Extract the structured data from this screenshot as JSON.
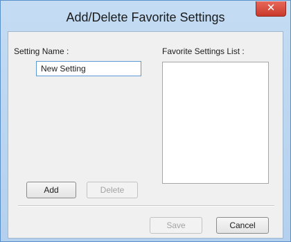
{
  "dialog": {
    "title": "Add/Delete Favorite Settings",
    "close_glyph": "✕"
  },
  "setting_name": {
    "label": "Setting Name :",
    "value": "New Setting"
  },
  "favorites": {
    "label": "Favorite Settings List :",
    "items": []
  },
  "buttons": {
    "add": "Add",
    "delete": "Delete",
    "save": "Save",
    "cancel": "Cancel"
  },
  "colors": {
    "title_bar": "#b9d4ef",
    "close_button": "#c8392b",
    "input_border": "#5b9bd5"
  }
}
